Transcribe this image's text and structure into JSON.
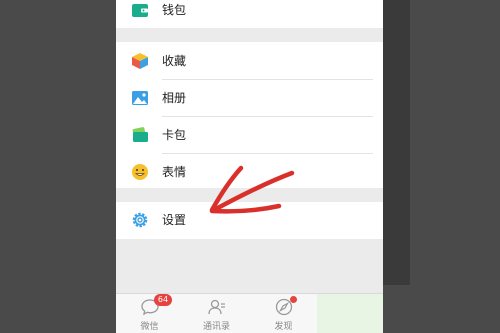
{
  "menu": {
    "wallet": "钱包",
    "favorites": "收藏",
    "album": "相册",
    "cards": "卡包",
    "stickers": "表情",
    "settings": "设置"
  },
  "tabbar": {
    "chats": "微信",
    "chats_badge": "64",
    "contacts": "通讯录",
    "discover": "发现"
  },
  "colors": {
    "accent_green": "#1aad19",
    "badge_red": "#e64340",
    "arrow_red": "#d9302c"
  }
}
